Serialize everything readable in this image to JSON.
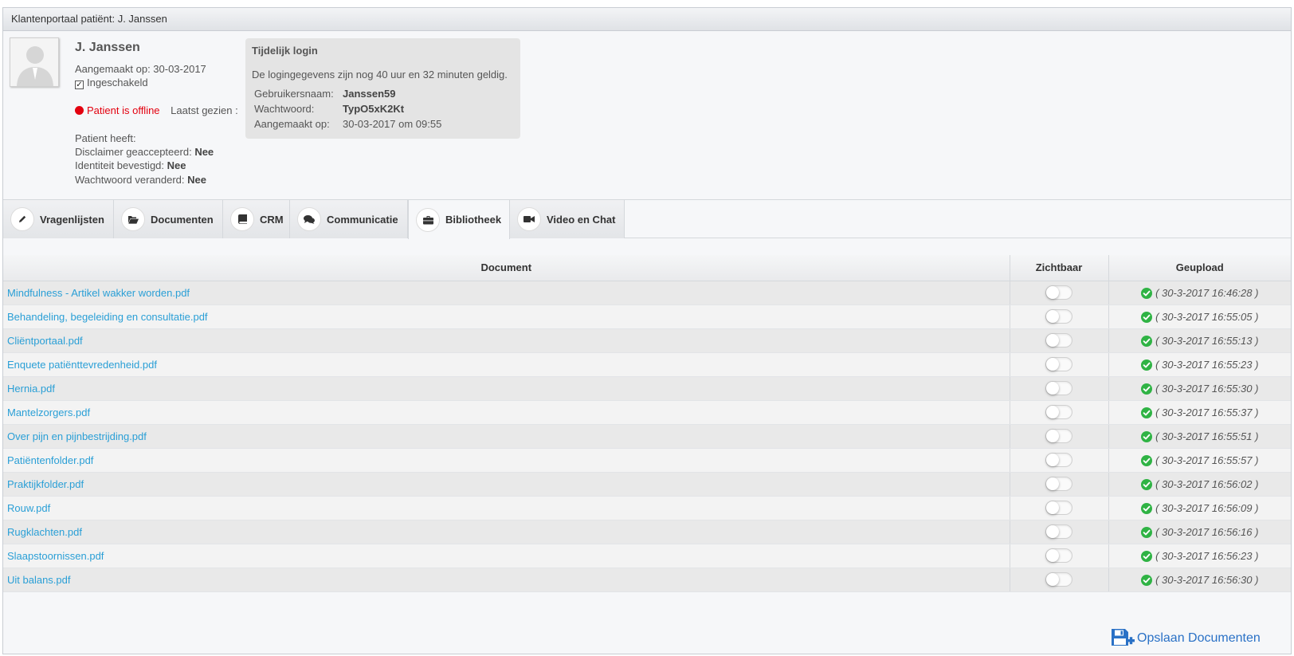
{
  "window": {
    "title": "Klantenportaal patiënt: J. Janssen"
  },
  "patient": {
    "name": "J. Janssen",
    "created": "Aangemaakt op: 30-03-2017",
    "enabled_label": "Ingeschakeld",
    "status": "Patient is offline",
    "last_seen": "Laatst gezien :",
    "has_label": "Patient heeft:",
    "disclaimer_label": "Disclaimer geaccepteerd:",
    "disclaimer_value": "Nee",
    "identity_label": "Identiteit bevestigd:",
    "identity_value": "Nee",
    "password_changed_label": "Wachtwoord veranderd:",
    "password_changed_value": "Nee"
  },
  "temp_login": {
    "title": "Tijdelijk login",
    "description": "De logingegevens zijn nog 40 uur en 32 minuten geldig.",
    "username_label": "Gebruikersnaam:",
    "username_value": "Janssen59",
    "password_label": "Wachtwoord:",
    "password_value": "TypO5xK2Kt",
    "created_label": "Aangemaakt op:",
    "created_value": "30-03-2017 om 09:55"
  },
  "tabs": [
    {
      "label": "Vragenlijsten",
      "icon": "pencil-icon"
    },
    {
      "label": "Documenten",
      "icon": "folder-open-icon"
    },
    {
      "label": "CRM",
      "icon": "book-icon"
    },
    {
      "label": "Communicatie",
      "icon": "comments-icon"
    },
    {
      "label": "Bibliotheek",
      "icon": "briefcase-icon",
      "active": true
    },
    {
      "label": "Video en Chat",
      "icon": "video-camera-icon"
    }
  ],
  "table": {
    "headers": {
      "document": "Document",
      "visible": "Zichtbaar",
      "uploaded": "Geupload"
    },
    "rows": [
      {
        "doc": "Mindfulness - Artikel wakker worden.pdf",
        "uploaded": "( 30-3-2017 16:46:28 )",
        "visible": false
      },
      {
        "doc": "Behandeling, begeleiding en consultatie.pdf",
        "uploaded": "( 30-3-2017 16:55:05 )",
        "visible": false
      },
      {
        "doc": "Cliëntportaal.pdf",
        "uploaded": "( 30-3-2017 16:55:13 )",
        "visible": false
      },
      {
        "doc": "Enquete patiënttevredenheid.pdf",
        "uploaded": "( 30-3-2017 16:55:23 )",
        "visible": false
      },
      {
        "doc": "Hernia.pdf",
        "uploaded": "( 30-3-2017 16:55:30 )",
        "visible": false
      },
      {
        "doc": "Mantelzorgers.pdf",
        "uploaded": "( 30-3-2017 16:55:37 )",
        "visible": false
      },
      {
        "doc": "Over pijn en pijnbestrijding.pdf",
        "uploaded": "( 30-3-2017 16:55:51 )",
        "visible": false
      },
      {
        "doc": "Patiëntenfolder.pdf",
        "uploaded": "( 30-3-2017 16:55:57 )",
        "visible": false
      },
      {
        "doc": "Praktijkfolder.pdf",
        "uploaded": "( 30-3-2017 16:56:02 )",
        "visible": false
      },
      {
        "doc": "Rouw.pdf",
        "uploaded": "( 30-3-2017 16:56:09 )",
        "visible": false
      },
      {
        "doc": "Rugklachten.pdf",
        "uploaded": "( 30-3-2017 16:56:16 )",
        "visible": false
      },
      {
        "doc": "Slaapstoornissen.pdf",
        "uploaded": "( 30-3-2017 16:56:23 )",
        "visible": false
      },
      {
        "doc": "Uit balans.pdf",
        "uploaded": "( 30-3-2017 16:56:30 )",
        "visible": false
      }
    ]
  },
  "save_button": {
    "label": "Opslaan Documenten",
    "icon": "save-plus-icon"
  },
  "colors": {
    "link": "#2a9fd6",
    "offline": "#e3000f",
    "check": "#2fb344",
    "save": "#2a71c6"
  }
}
